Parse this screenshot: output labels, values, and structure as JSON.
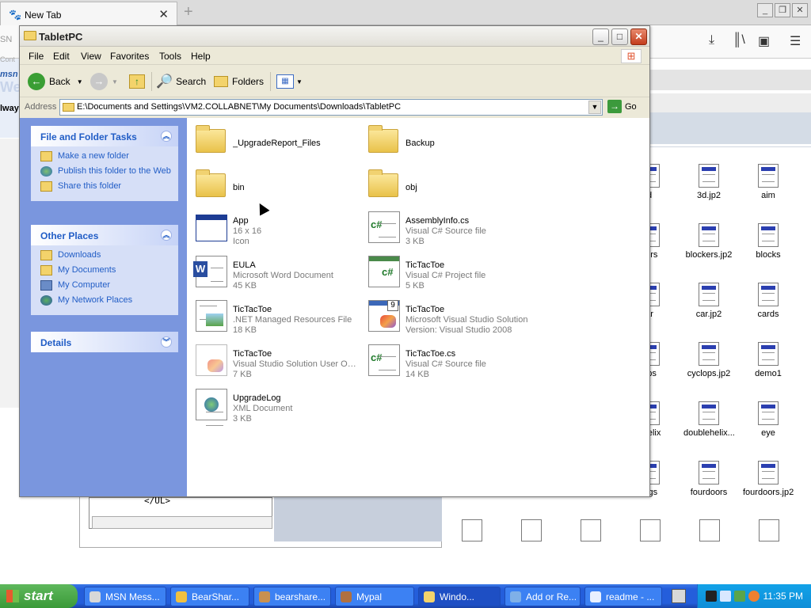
{
  "browser": {
    "tab_title": "New Tab",
    "close_glyph": "✕",
    "new_tab_glyph": "+",
    "min_glyph": "_",
    "restore_glyph": "❐",
    "close_window_glyph": "✕",
    "toolbar_icons": [
      "download-icon",
      "library-icon",
      "sidebar-icon",
      "menu-icon"
    ],
    "left_fragments": [
      "SN",
      "Cont",
      "msn",
      "We",
      "lway"
    ]
  },
  "background_files": [
    {
      "name": "d"
    },
    {
      "name": "3d.jp2"
    },
    {
      "name": "aim"
    },
    {
      "name": "kers"
    },
    {
      "name": "blockers.jp2"
    },
    {
      "name": "blocks"
    },
    {
      "name": "ar"
    },
    {
      "name": "car.jp2"
    },
    {
      "name": "cards"
    },
    {
      "name": "ops"
    },
    {
      "name": "cyclops.jp2"
    },
    {
      "name": "demo1"
    },
    {
      "name": "ehelix"
    },
    {
      "name": "doublehelix..."
    },
    {
      "name": "eye"
    },
    {
      "name": "ings"
    },
    {
      "name": "fourdoors"
    },
    {
      "name": "fourdoors.jp2"
    }
  ],
  "background_editor": {
    "code": "</UL>"
  },
  "window": {
    "title": "TabletPC",
    "min_glyph": "_",
    "max_glyph": "□",
    "close_glyph": "✕"
  },
  "menu": [
    "File",
    "Edit",
    "View",
    "Favorites",
    "Tools",
    "Help"
  ],
  "toolbar": {
    "back_label": "Back",
    "search_label": "Search",
    "folders_label": "Folders"
  },
  "address": {
    "label": "Address",
    "value": "E:\\Documents and Settings\\VM2.COLLABNET\\My Documents\\Downloads\\TabletPC",
    "go_label": "Go"
  },
  "tasks_panel": {
    "title": "File and Folder Tasks",
    "items": [
      {
        "label": "Make a new folder",
        "icon": "new-folder-icon"
      },
      {
        "label": "Publish this folder to the Web",
        "icon": "publish-web-icon"
      },
      {
        "label": "Share this folder",
        "icon": "share-folder-icon"
      }
    ]
  },
  "places_panel": {
    "title": "Other Places",
    "items": [
      {
        "label": "Downloads",
        "icon": "folder-icon"
      },
      {
        "label": "My Documents",
        "icon": "my-documents-icon"
      },
      {
        "label": "My Computer",
        "icon": "my-computer-icon"
      },
      {
        "label": "My Network Places",
        "icon": "network-places-icon"
      }
    ]
  },
  "details_panel": {
    "title": "Details"
  },
  "files": [
    {
      "name": "_UpgradeReport_Files",
      "d1": "",
      "d2": "",
      "icon": "folder"
    },
    {
      "name": "Backup",
      "d1": "",
      "d2": "",
      "icon": "folder"
    },
    {
      "name": "bin",
      "d1": "",
      "d2": "",
      "icon": "folder"
    },
    {
      "name": "obj",
      "d1": "",
      "d2": "",
      "icon": "folder"
    },
    {
      "name": "App",
      "d1": "16 x 16",
      "d2": "Icon",
      "icon": "app-icon"
    },
    {
      "name": "AssemblyInfo.cs",
      "d1": "Visual C# Source file",
      "d2": "3 KB",
      "icon": "cs-file"
    },
    {
      "name": "EULA",
      "d1": "Microsoft Word Document",
      "d2": "45 KB",
      "icon": "word-doc"
    },
    {
      "name": "TicTacToe",
      "d1": "Visual C# Project file",
      "d2": "5 KB",
      "icon": "cs-project"
    },
    {
      "name": "TicTacToe",
      "d1": ".NET Managed Resources File",
      "d2": "18 KB",
      "icon": "resx-file"
    },
    {
      "name": "TicTacToe",
      "d1": "Microsoft Visual Studio Solution",
      "d2": "Version: Visual Studio 2008",
      "icon": "vs-solution"
    },
    {
      "name": "TicTacToe",
      "d1": "Visual Studio Solution User Op...",
      "d2": "7 KB",
      "icon": "suo-file"
    },
    {
      "name": "TicTacToe.cs",
      "d1": "Visual C# Source file",
      "d2": "14 KB",
      "icon": "cs-file"
    },
    {
      "name": "UpgradeLog",
      "d1": "XML Document",
      "d2": "3 KB",
      "icon": "xml-doc"
    }
  ],
  "taskbar": {
    "start_label": "start",
    "buttons": [
      {
        "label": "MSN Mess..."
      },
      {
        "label": "BearShar..."
      },
      {
        "label": "bearshare..."
      },
      {
        "label": "Mypal"
      },
      {
        "label": "Windo..."
      },
      {
        "label": "Add or Re..."
      },
      {
        "label": "readme - ..."
      }
    ],
    "clock": "11:35 PM"
  }
}
